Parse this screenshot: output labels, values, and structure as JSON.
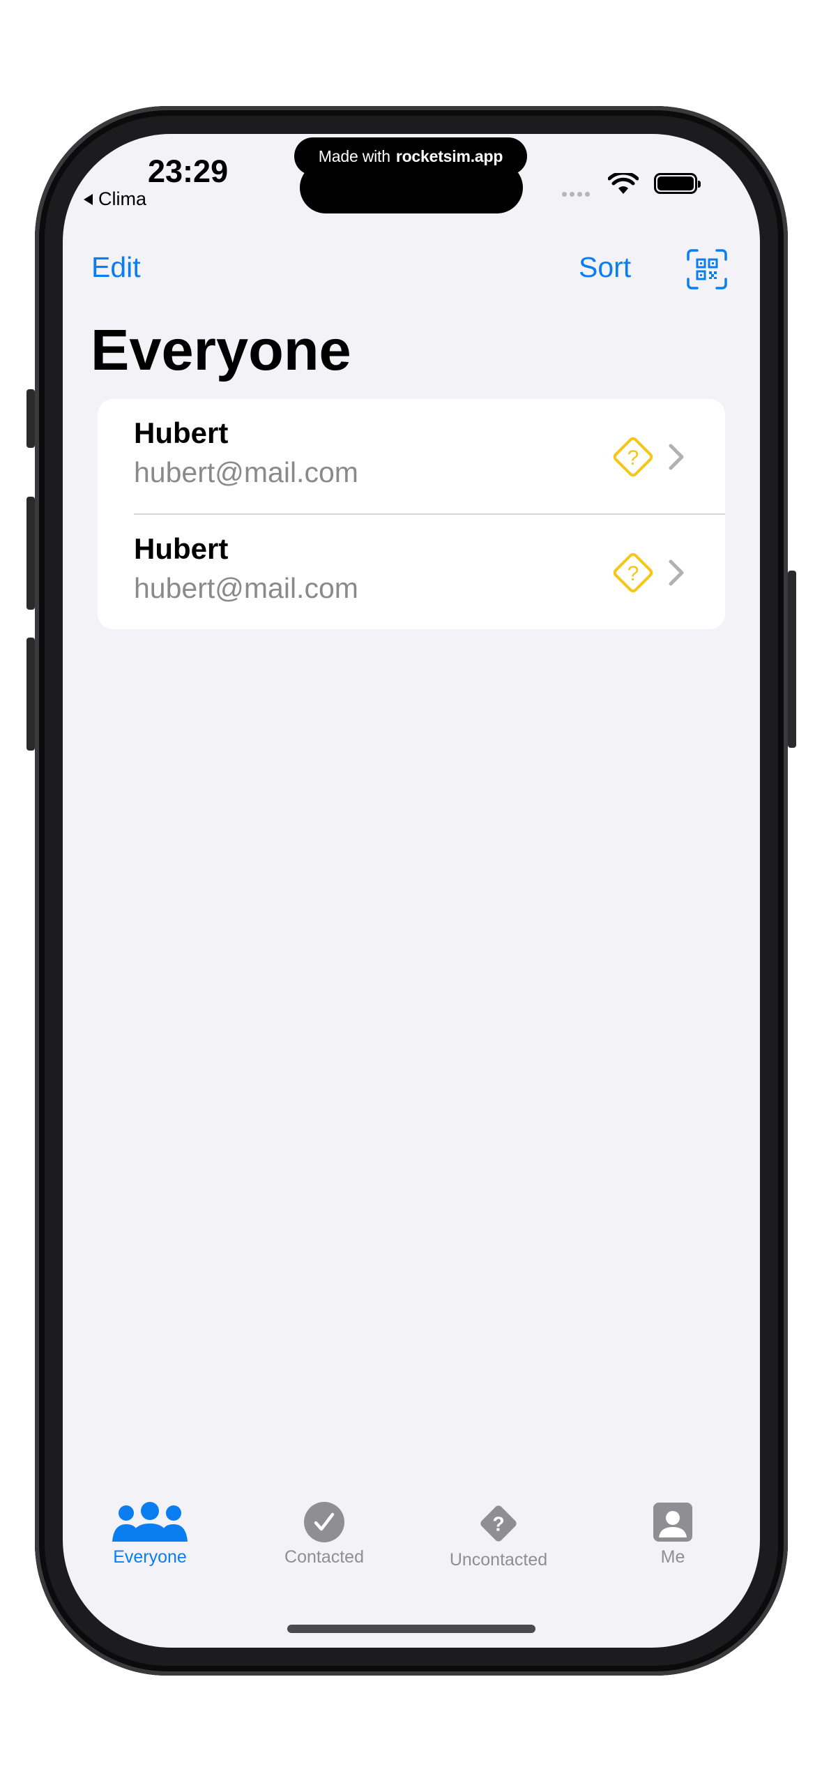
{
  "banner": {
    "prefix": "Made with",
    "brand": "rocketsim.app"
  },
  "status_bar": {
    "time": "23:29",
    "back_app": "Clima"
  },
  "nav": {
    "edit_label": "Edit",
    "sort_label": "Sort",
    "scan_icon": "qr-scan-icon"
  },
  "page": {
    "title": "Everyone"
  },
  "contacts": [
    {
      "name": "Hubert",
      "email": "hubert@mail.com",
      "status_icon": "uncontacted-diamond-icon"
    },
    {
      "name": "Hubert",
      "email": "hubert@mail.com",
      "status_icon": "uncontacted-diamond-icon"
    }
  ],
  "tabs": [
    {
      "label": "Everyone",
      "icon": "people-icon",
      "selected": true
    },
    {
      "label": "Contacted",
      "icon": "checkmark-circle-icon",
      "selected": false
    },
    {
      "label": "Uncontacted",
      "icon": "question-diamond-icon",
      "selected": false
    },
    {
      "label": "Me",
      "icon": "person-square-icon",
      "selected": false
    }
  ],
  "colors": {
    "accent": "#0a7ef0",
    "warning": "#f5c518",
    "background": "#f2f2f7",
    "inactive": "#8e8e93"
  }
}
